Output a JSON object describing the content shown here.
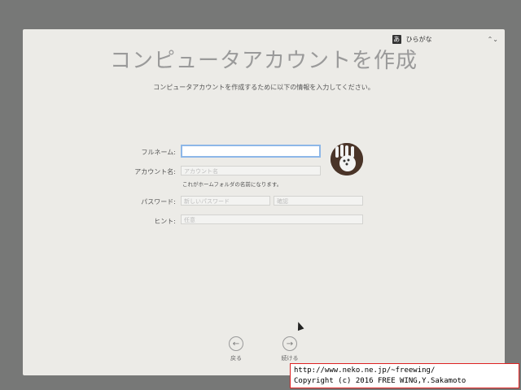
{
  "ime": {
    "badge": "あ",
    "label": "ひらがな",
    "arrow": "⌃⌄"
  },
  "page": {
    "title": "コンピュータアカウントを作成",
    "subtitle": "コンピュータアカウントを作成するために以下の情報を入力してください。"
  },
  "form": {
    "fullname_label": "フルネーム:",
    "fullname_value": "",
    "account_label": "アカウント名:",
    "account_placeholder": "アカウント名",
    "account_hint": "これがホームフォルダの名前になります。",
    "password_label": "パスワード:",
    "password_placeholder": "新しいパスワード",
    "verify_placeholder": "確認",
    "hint_label": "ヒント:",
    "hint_placeholder": "任意"
  },
  "nav": {
    "back_label": "戻る",
    "continue_label": "続ける"
  },
  "watermark": {
    "line1": "http://www.neko.ne.jp/~freewing/",
    "line2": "Copyright (c) 2016 FREE WING,Y.Sakamoto"
  }
}
